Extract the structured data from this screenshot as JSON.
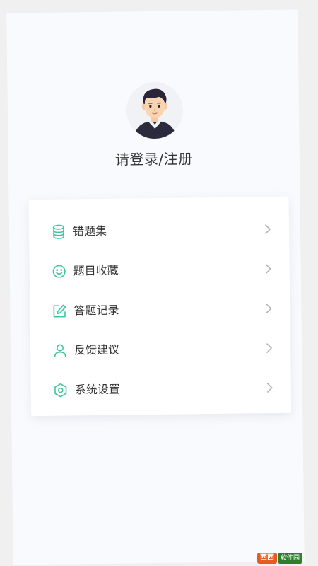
{
  "profile": {
    "login_label": "请登录/注册"
  },
  "menu": {
    "items": [
      {
        "label": "错题集",
        "icon": "database-icon"
      },
      {
        "label": "题目收藏",
        "icon": "smile-icon"
      },
      {
        "label": "答题记录",
        "icon": "edit-icon"
      },
      {
        "label": "反馈建议",
        "icon": "user-icon"
      },
      {
        "label": "系统设置",
        "icon": "settings-icon"
      }
    ]
  },
  "watermark": {
    "logo_text": "西西",
    "site_text": "软件园"
  },
  "colors": {
    "accent": "#3ec59e",
    "screen_bg": "#f9fafd",
    "card_bg": "#ffffff",
    "text": "#333333",
    "chevron": "#b3b3b3"
  }
}
